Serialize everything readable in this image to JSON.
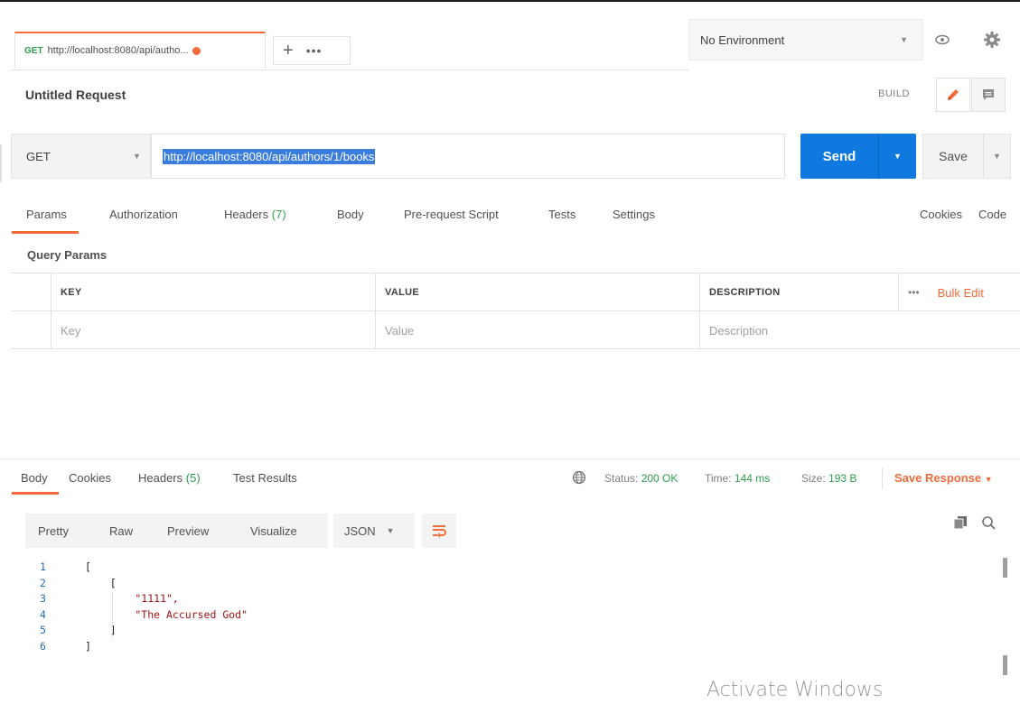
{
  "tab": {
    "method": "GET",
    "title": "http://localhost:8080/api/autho..."
  },
  "tab_actions": {
    "add": "+",
    "more": "•••"
  },
  "environment": {
    "selected": "No Environment"
  },
  "request": {
    "title": "Untitled Request",
    "build_label": "BUILD",
    "method": "GET",
    "url": "http://localhost:8080/api/authors/1/books",
    "send_label": "Send",
    "save_label": "Save"
  },
  "request_tabs": {
    "params": "Params",
    "authorization": "Authorization",
    "headers": "Headers",
    "headers_count": "(7)",
    "body": "Body",
    "prerequest": "Pre-request Script",
    "tests": "Tests",
    "settings": "Settings",
    "cookies": "Cookies",
    "code": "Code"
  },
  "params": {
    "section_title": "Query Params",
    "columns": {
      "key": "KEY",
      "value": "VALUE",
      "description": "DESCRIPTION"
    },
    "more": "•••",
    "bulk_edit": "Bulk Edit",
    "placeholders": {
      "key": "Key",
      "value": "Value",
      "description": "Description"
    }
  },
  "response_tabs": {
    "body": "Body",
    "cookies": "Cookies",
    "headers": "Headers",
    "headers_count": "(5)",
    "test_results": "Test Results"
  },
  "status": {
    "status_label": "Status:",
    "status_value": "200 OK",
    "time_label": "Time:",
    "time_value": "144 ms",
    "size_label": "Size:",
    "size_value": "193 B",
    "save_response": "Save Response",
    "save_response_caret": "▼"
  },
  "view": {
    "pretty": "Pretty",
    "raw": "Raw",
    "preview": "Preview",
    "visualize": "Visualize",
    "format": "JSON"
  },
  "code_lines": [
    {
      "num": "1",
      "text": "["
    },
    {
      "num": "2",
      "text": "    ["
    },
    {
      "num": "3",
      "text": "        \"1111\","
    },
    {
      "num": "4",
      "text": "        \"The Accursed God\""
    },
    {
      "num": "5",
      "text": "    ]"
    },
    {
      "num": "6",
      "text": "]"
    }
  ],
  "watermark": "Activate Windows",
  "colors": {
    "accent": "#f26b3a",
    "send": "#0f79e0",
    "success": "#2e9e4f"
  }
}
